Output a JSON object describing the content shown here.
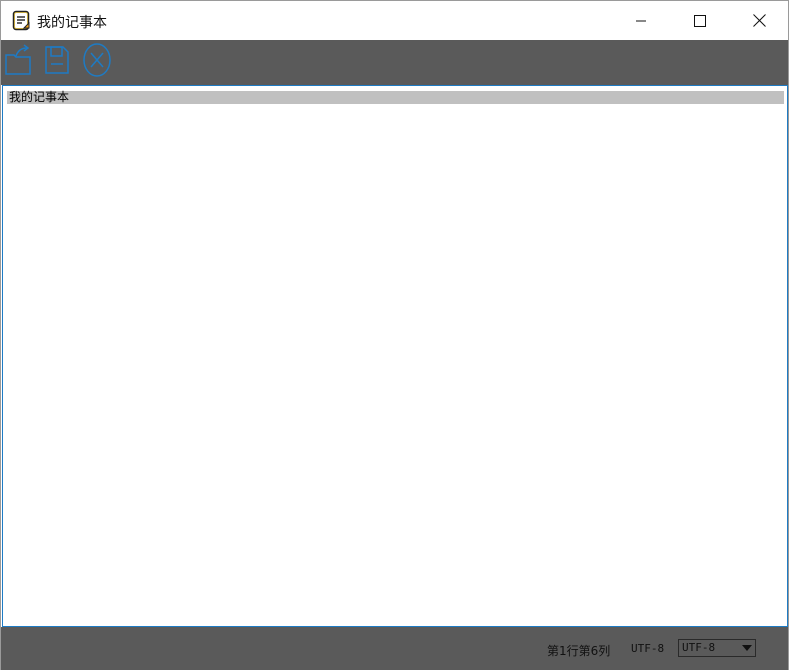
{
  "window": {
    "title": "我的记事本",
    "app_icon": "notepad-icon",
    "controls": {
      "minimize_icon": "minimize-icon",
      "maximize_icon": "maximize-icon",
      "close_icon": "close-icon"
    }
  },
  "toolbar": {
    "items": [
      {
        "name": "open-file-button",
        "icon": "open-folder-icon"
      },
      {
        "name": "save-file-button",
        "icon": "save-icon"
      },
      {
        "name": "close-file-button",
        "icon": "close-circle-icon"
      }
    ],
    "accent_color": "#1e7bc4",
    "background": "#5a5a5a"
  },
  "editor": {
    "content": "我的记事本",
    "current_line_highlight": "#c0c0c0",
    "border_color": "#1e7bc4"
  },
  "statusbar": {
    "cursor_position": "第1行第6列",
    "encoding_label": "UTF-8",
    "encoding_select": {
      "selected": "UTF-8"
    }
  }
}
